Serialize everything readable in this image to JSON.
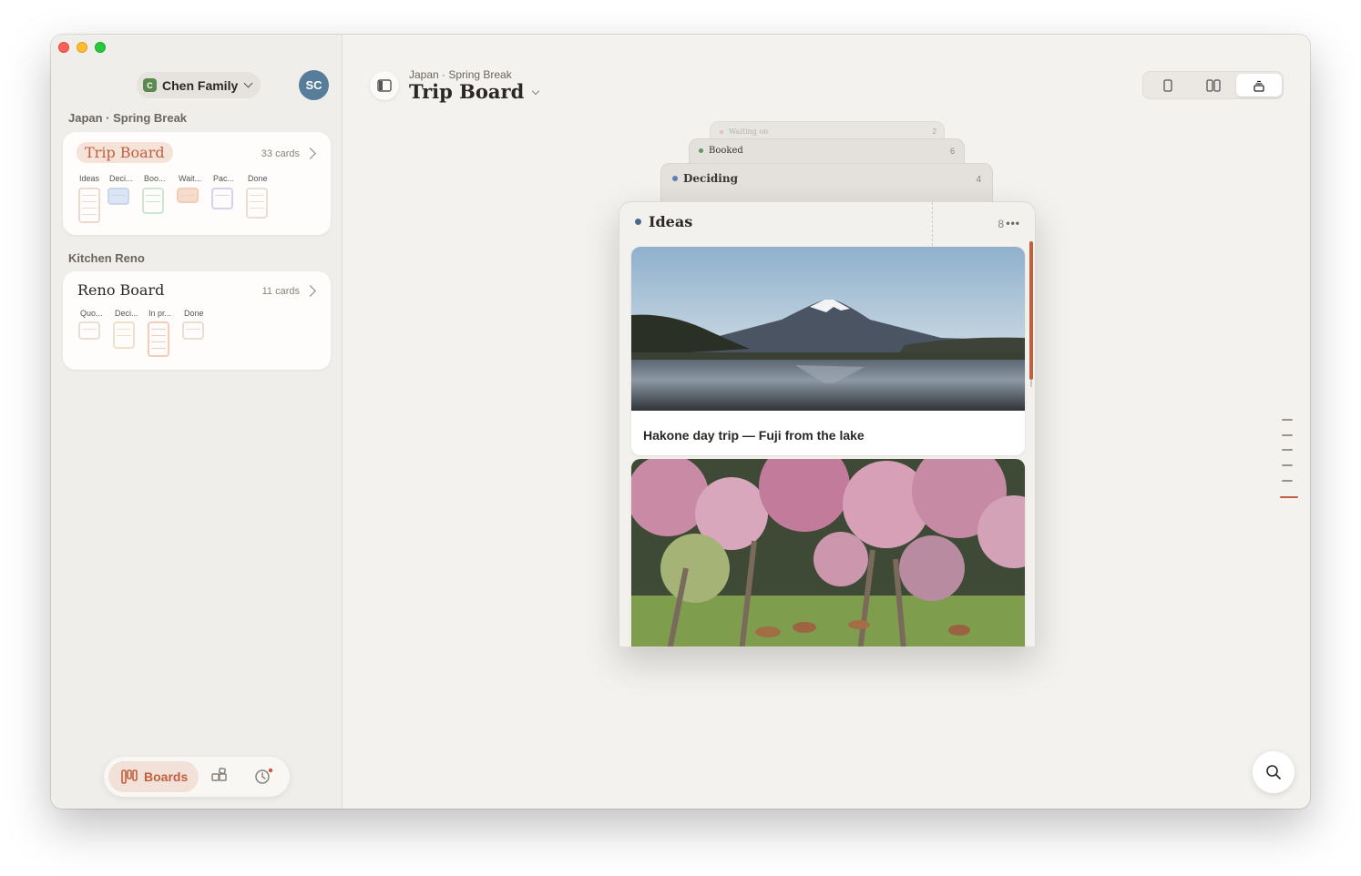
{
  "sidebar": {
    "family": {
      "initial": "C",
      "name": "Chen Family"
    },
    "avatar_initials": "SC",
    "sections": [
      {
        "label": "Japan · Spring Break",
        "board": {
          "title": "Trip Board",
          "count": "33 cards",
          "columns": [
            "Ideas",
            "Deci...",
            "Boo...",
            "Wait...",
            "Pac...",
            "Done"
          ]
        }
      },
      {
        "label": "Kitchen Reno",
        "board": {
          "title": "Reno Board",
          "count": "11 cards",
          "columns": [
            "Quo...",
            "Deci...",
            "In pr...",
            "Done"
          ]
        }
      }
    ],
    "tabs": {
      "boards_label": "Boards"
    }
  },
  "header": {
    "breadcrumb": "Japan · Spring Break",
    "title": "Trip Board"
  },
  "stack": [
    {
      "name": "Waiting on",
      "count": "2",
      "color": "#e8a898"
    },
    {
      "name": "Booked",
      "count": "6",
      "color": "#5b9a5e"
    },
    {
      "name": "Deciding",
      "count": "4",
      "color": "#5b82b8"
    }
  ],
  "ideas": {
    "name": "Ideas",
    "count": "8",
    "more": "•••",
    "color": "#4a6a8c",
    "cards": [
      {
        "caption": "Hakone day trip — Fuji from the lake"
      }
    ]
  },
  "colors": {
    "accent": "#c0603c"
  },
  "icons": [
    "sidebar-toggle-icon",
    "single-column-icon",
    "two-column-icon",
    "stack-icon",
    "boards-icon",
    "widgets-icon",
    "clock-icon",
    "search-icon"
  ]
}
